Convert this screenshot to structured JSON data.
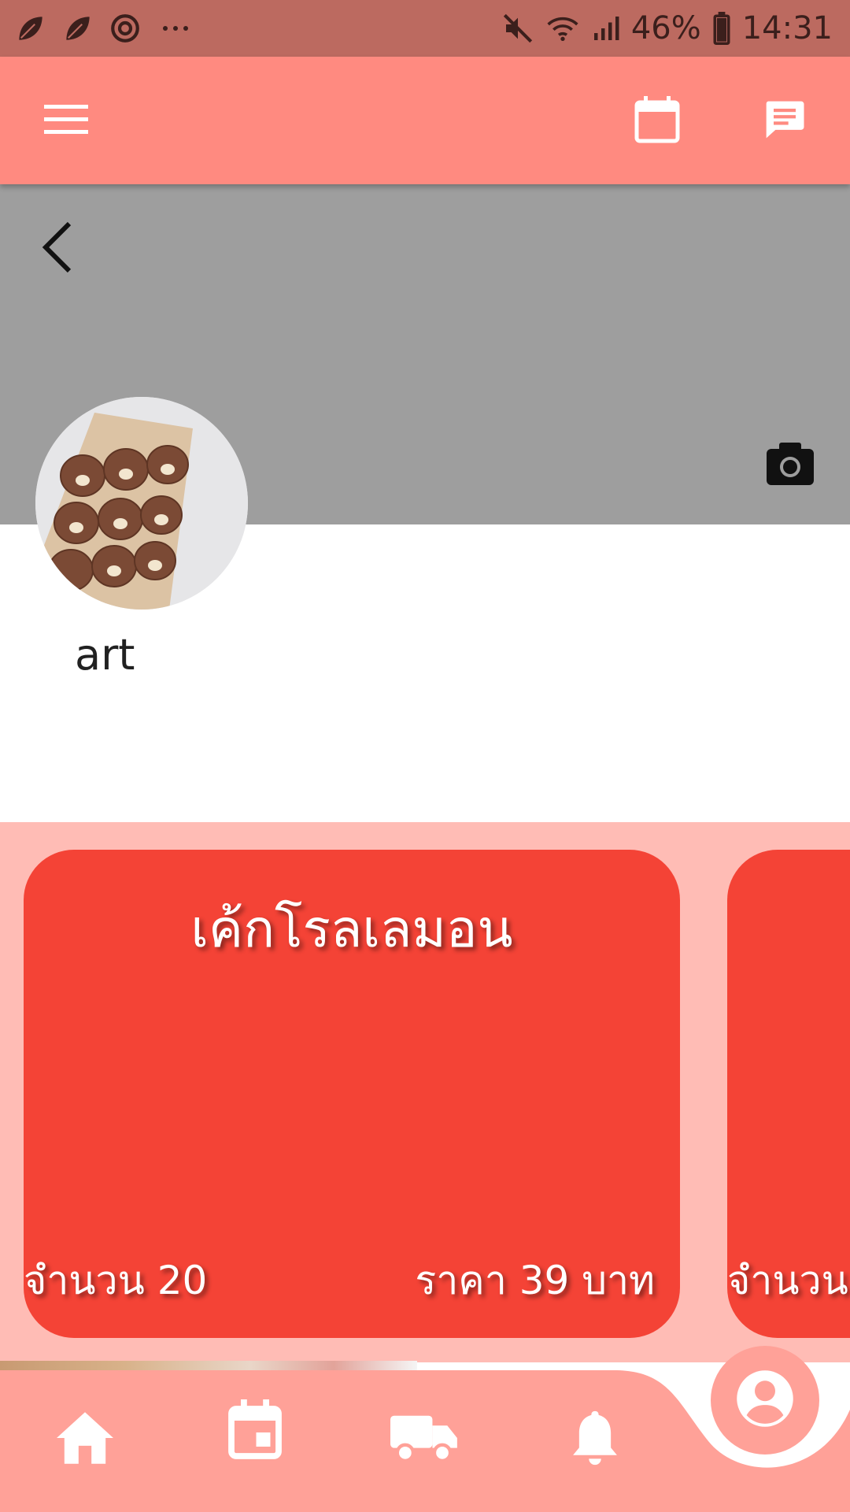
{
  "status_bar": {
    "battery": "46%",
    "time": "14:31"
  },
  "profile": {
    "name": "art"
  },
  "products": [
    {
      "name": "เค้กโรลเลมอน",
      "quantity": "จำนวน 20",
      "price": "ราคา 39 บาท"
    },
    {
      "name": "",
      "quantity": "จำนวน",
      "price": ""
    }
  ],
  "colors": {
    "status_bar": "#BC6A60",
    "app_bar": "#FF8A80",
    "cover": "#9E9E9E",
    "products_bg": "#FFBCB5",
    "card": "#F44336",
    "bottom_nav": "#FFA198"
  },
  "icons": {
    "app_bar": [
      "menu-icon",
      "calendar-icon",
      "chat-icon"
    ],
    "bottom_nav": [
      "home-icon",
      "event-icon",
      "truck-icon",
      "bell-icon",
      "account-icon"
    ]
  }
}
